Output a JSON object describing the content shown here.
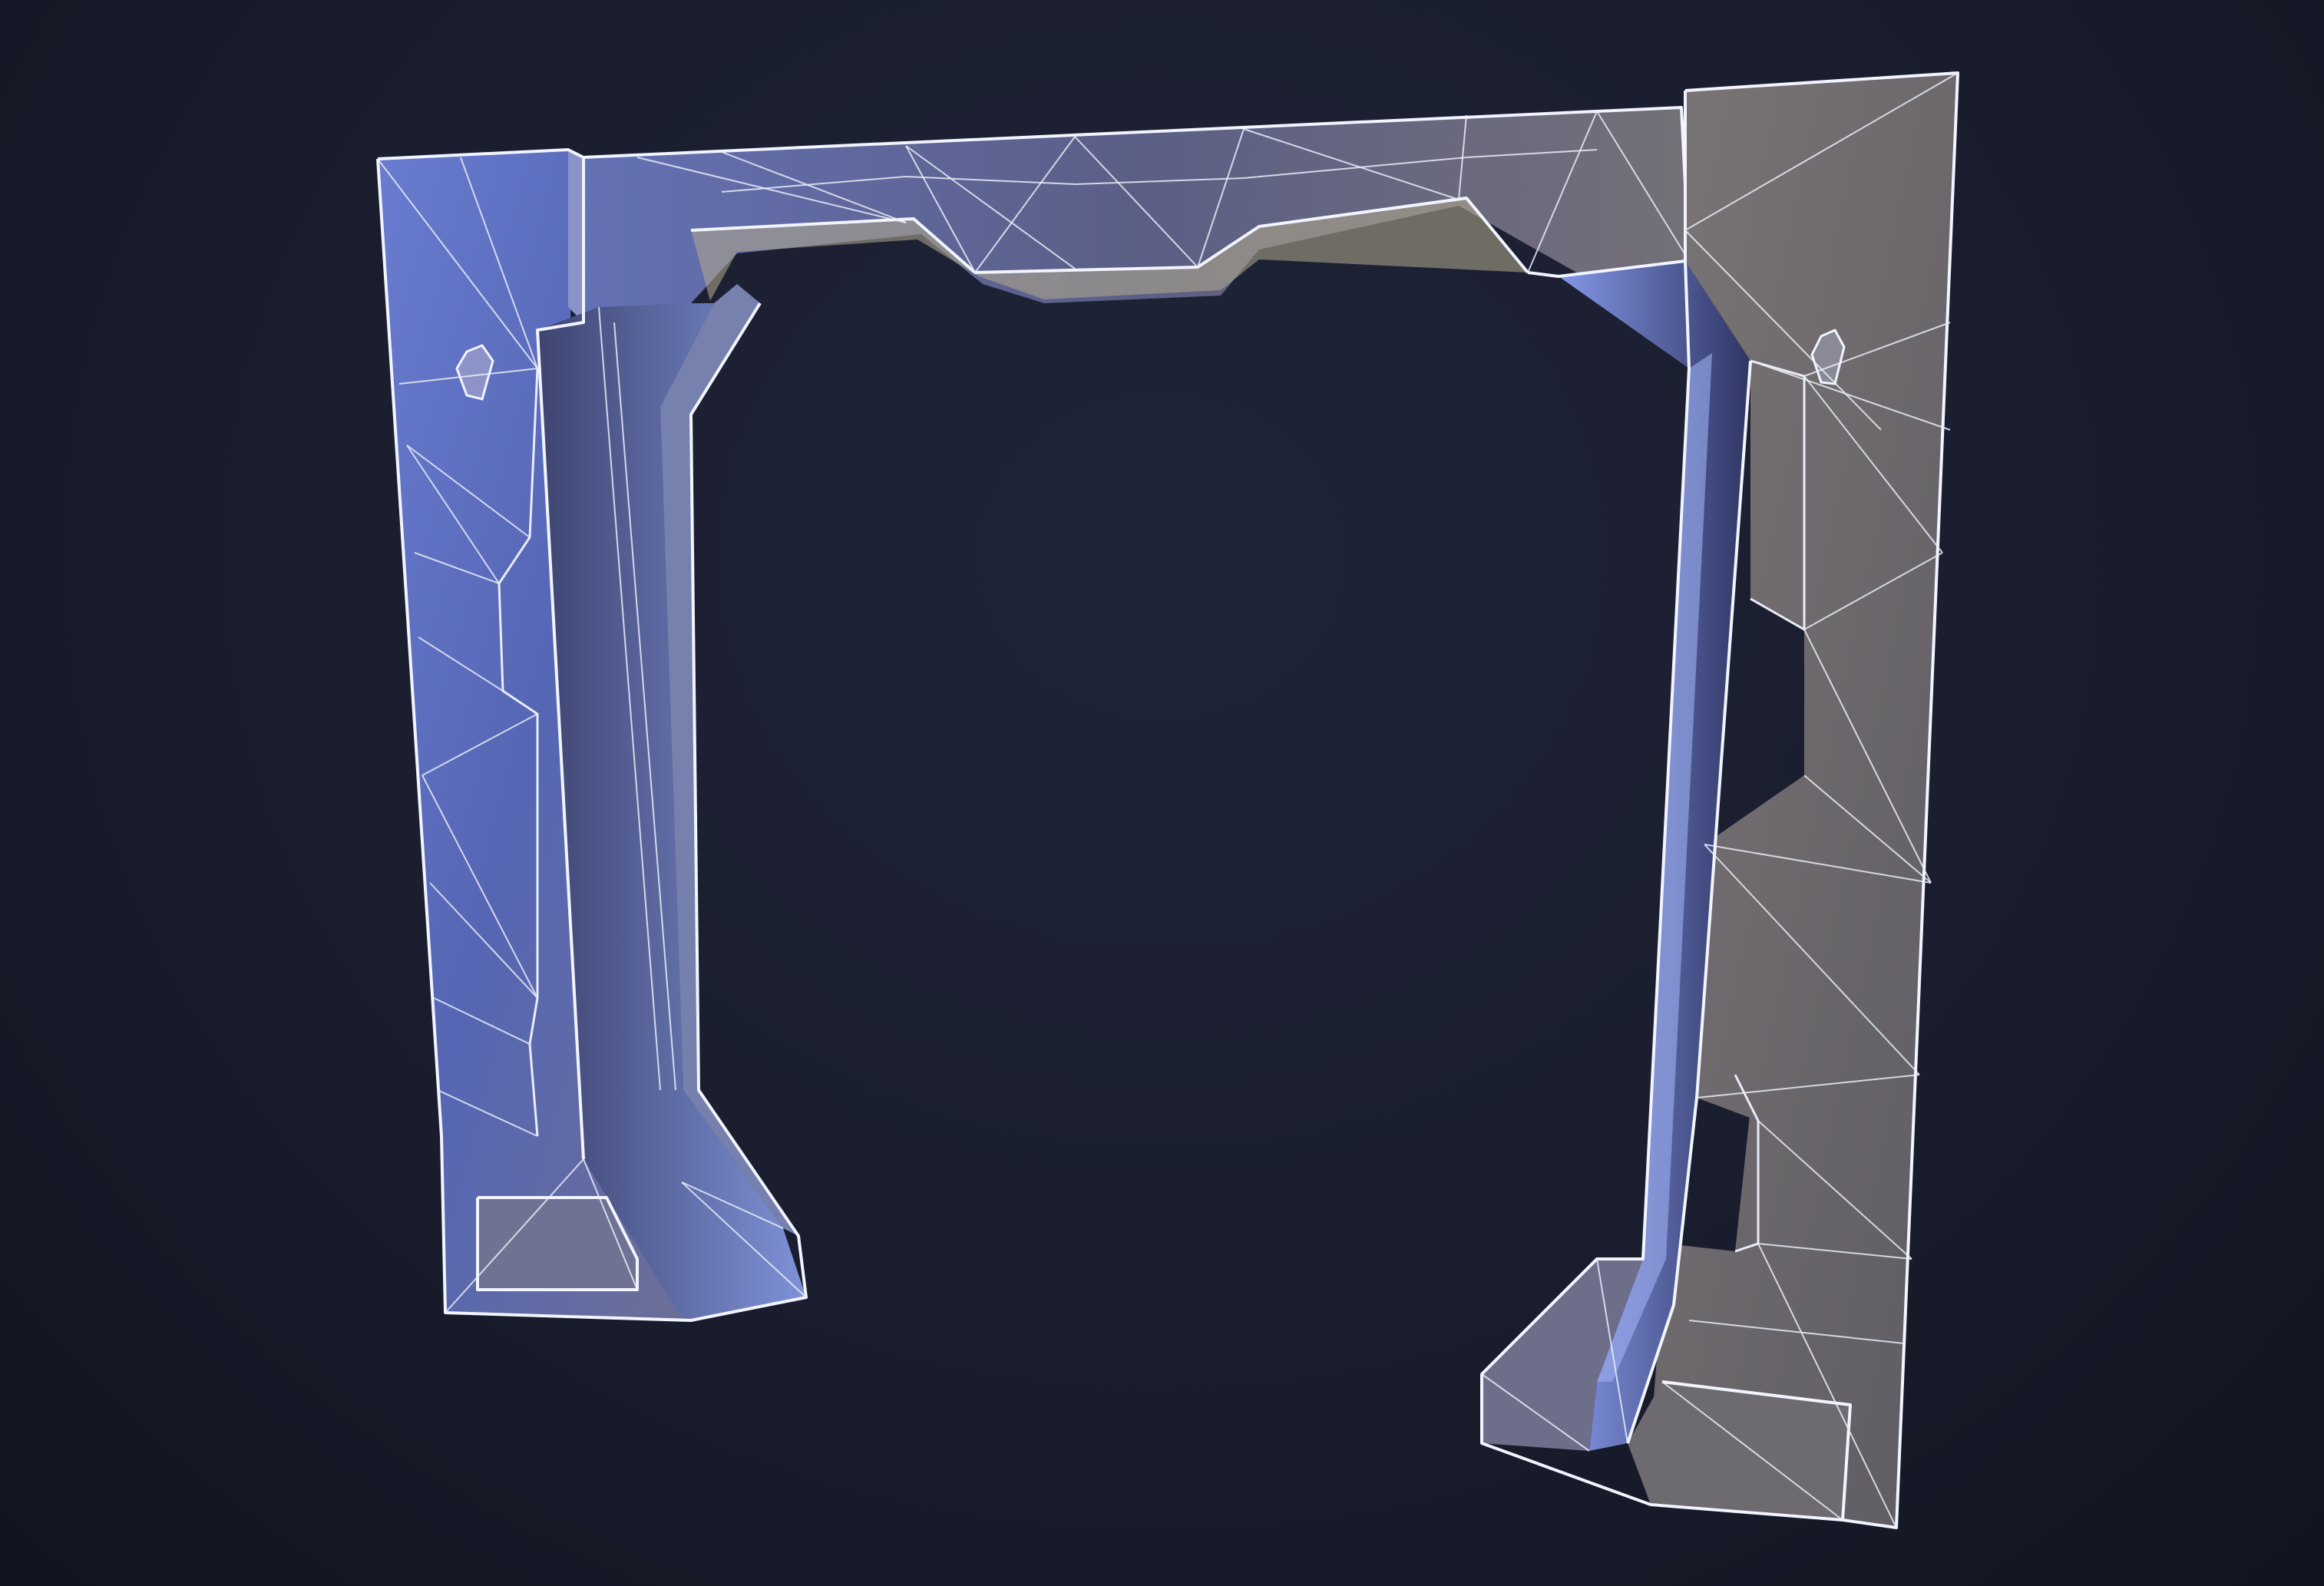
{
  "scene": {
    "subject": "wireframe-arch-model",
    "render_mode": "shaded-wireframe",
    "colors": {
      "background": "#191d2d",
      "left_pillar": "#5a6cb8",
      "right_pillar": "#6b6870",
      "beam": "#555a80",
      "wire": "#e9ecf8",
      "highlight": "#8a9cf0"
    }
  }
}
